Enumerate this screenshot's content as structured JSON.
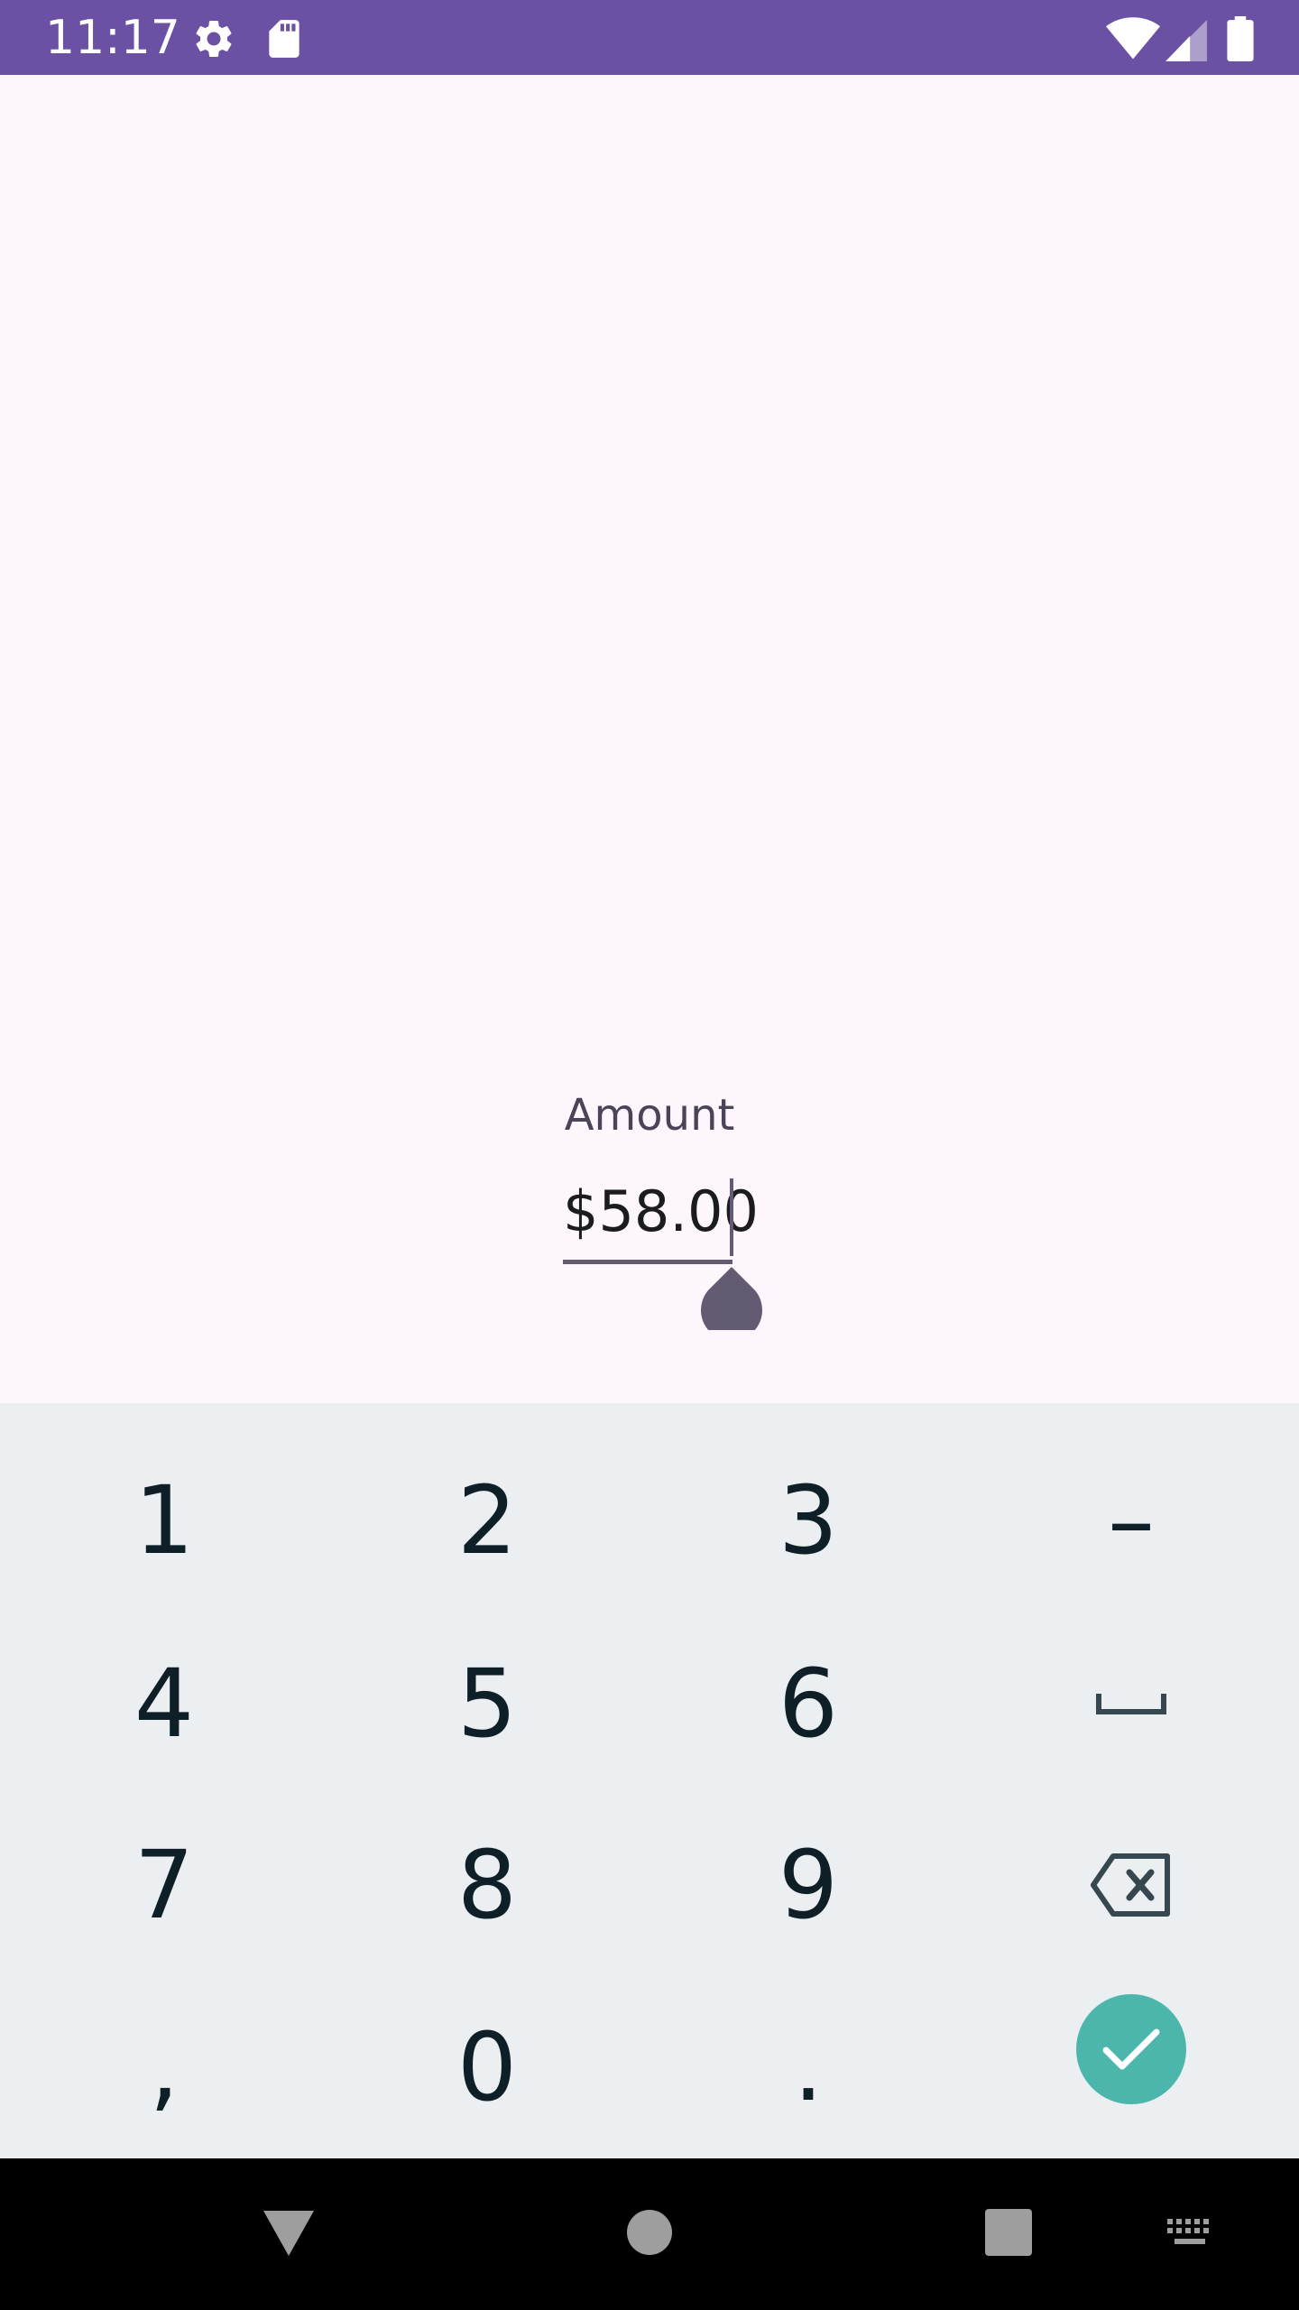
{
  "status_bar": {
    "time": "11:17",
    "icons": [
      "gear-icon",
      "sd-card-icon",
      "wifi-icon",
      "signal-icon",
      "battery-icon"
    ],
    "background_color": "#6a51a3"
  },
  "form": {
    "amount_label": "Amount",
    "amount_value": "$58.00"
  },
  "keyboard": {
    "keys": {
      "k1": "1",
      "k2": "2",
      "k3": "3",
      "minus": "–",
      "k4": "4",
      "k5": "5",
      "k6": "6",
      "k7": "7",
      "k8": "8",
      "k9": "9",
      "comma": ",",
      "k0": "0",
      "period": "."
    },
    "special_keys": [
      "space-icon",
      "backspace-icon",
      "checkmark-icon"
    ],
    "done_color": "#4db6ac",
    "background_color": "#ebeff2"
  },
  "nav_bar": {
    "buttons": [
      "back-icon",
      "home-icon",
      "recents-icon",
      "keyboard-switch-icon"
    ]
  }
}
